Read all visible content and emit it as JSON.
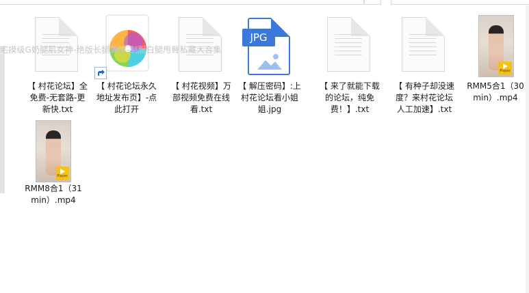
{
  "overlay_text": "宅摸级G奶腿肌女神-绝版长腿美腿-制服白腿甩臀私藏大合集",
  "files": [
    {
      "name": "【 村花论坛】全免费-无套路-更新快.txt",
      "type": "txt"
    },
    {
      "name": "【 村花论坛永久地址发布页】-点此打开",
      "type": "shortcut"
    },
    {
      "name": "【 村花视频】万部视频免费在线看.txt",
      "type": "txt"
    },
    {
      "name": "【 解压密码】:上村花论坛看小姐姐.jpg",
      "type": "jpg",
      "badge": "JPG"
    },
    {
      "name": "【 来了就能下载的论坛，纯免费！】.txt",
      "type": "txt"
    },
    {
      "name": "【 有种子却没速度？来村花论坛人工加速】.txt",
      "type": "txt"
    },
    {
      "name": "RMM5合1（30min）.mp4",
      "type": "mp4",
      "badge": "Player"
    },
    {
      "name": "RMM8合1（31min）.mp4",
      "type": "mp4",
      "badge": "Player"
    }
  ],
  "colors": {
    "jpg_accent": "#3b79d8",
    "player_badge": "#f3c21a"
  },
  "icons": {
    "txt": "document-icon",
    "shortcut": "browser-app-icon",
    "jpg": "jpg-file-icon",
    "mp4": "video-thumbnail-icon"
  }
}
